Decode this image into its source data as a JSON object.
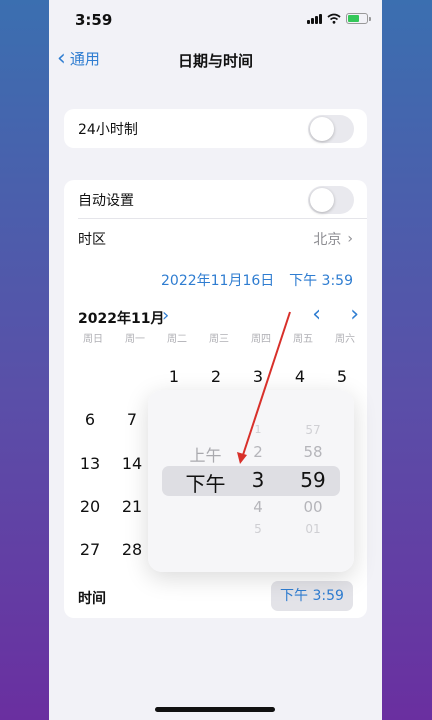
{
  "status_bar": {
    "time": "3:59"
  },
  "nav": {
    "back_label": "通用",
    "title": "日期与时间"
  },
  "settings": {
    "hour24_label": "24小时制",
    "auto_set_label": "自动设置",
    "timezone_label": "时区",
    "timezone_value": "北京"
  },
  "current": {
    "date": "2022年11月16日",
    "time": "下午 3:59"
  },
  "calendar": {
    "month_label": "2022年11月",
    "weekdays": [
      "周日",
      "周一",
      "周二",
      "周三",
      "周四",
      "周五",
      "周六"
    ],
    "visible_days": [
      "1",
      "2",
      "3",
      "4",
      "5",
      "6",
      "7",
      "13",
      "14",
      "20",
      "21",
      "27",
      "28"
    ]
  },
  "time_picker": {
    "period_column": [
      "上午",
      "下午"
    ],
    "hour_column": [
      "1",
      "2",
      "3",
      "4",
      "5"
    ],
    "minute_column": [
      "57",
      "58",
      "59",
      "00",
      "01"
    ],
    "selected": {
      "period": "下午",
      "hour": "3",
      "minute": "59"
    }
  },
  "time_row": {
    "label": "时间",
    "value": "下午 3:59"
  },
  "colors": {
    "accent": "#2f7dd1",
    "background": "#f2f2f7",
    "annotation_arrow": "#d8302a"
  }
}
